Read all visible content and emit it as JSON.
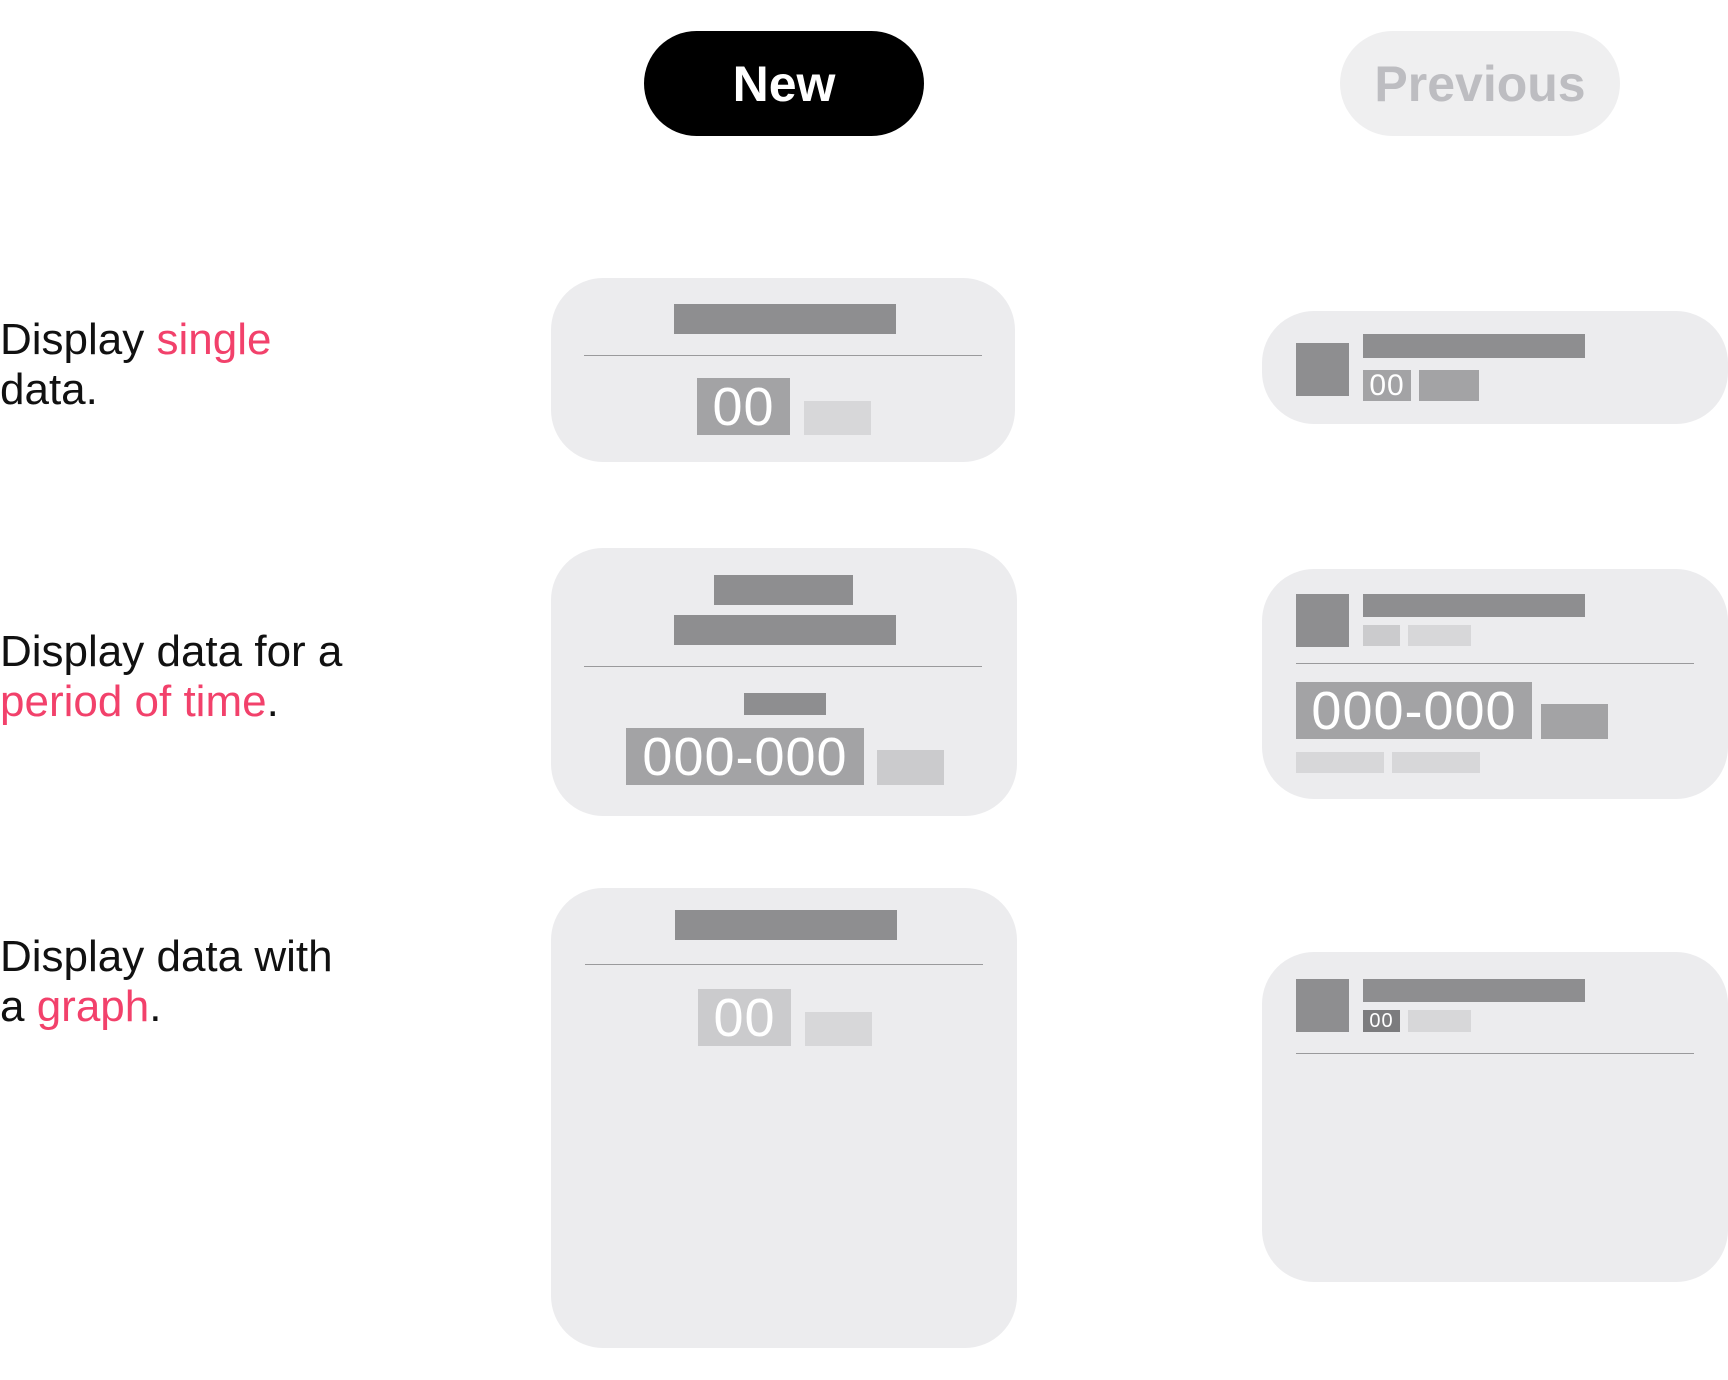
{
  "header": {
    "new_label": "New",
    "previous_label": "Previous"
  },
  "rows": [
    {
      "line1": "Display ",
      "line1_highlight": "single",
      "line2": "data.",
      "line2_highlight": "",
      "line2_tail": ""
    },
    {
      "line1": "Display data for a",
      "line1_highlight": "",
      "line2": "",
      "line2_highlight": "period of time",
      "line2_tail": "."
    },
    {
      "line1": "Display data with",
      "line1_highlight": "",
      "line2": "a ",
      "line2_highlight": "graph",
      "line2_tail": "."
    }
  ],
  "cards": {
    "new_single_value": "00",
    "new_period_value": "000-000",
    "new_graph_value": "00",
    "prev_single_value": "00",
    "prev_period_value": "000-000",
    "prev_graph_value": "00"
  },
  "colors": {
    "accent": "#f2416b",
    "card_bg": "#ececee",
    "placeholder": "#8e8e90"
  }
}
